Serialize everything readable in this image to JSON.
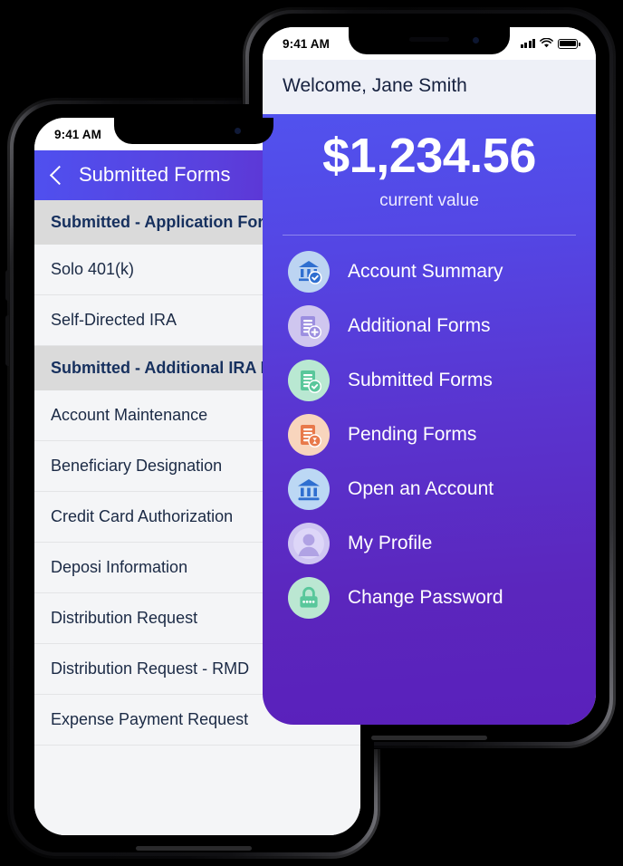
{
  "front_phone": {
    "status_bar": {
      "time": "9:41 AM",
      "signal_icon": "cellular-bars-icon",
      "wifi_icon": "wifi-icon",
      "battery_icon": "battery-full-icon"
    },
    "welcome": "Welcome, Jane Smith",
    "balance": {
      "amount": "$1,234.56",
      "caption": "current value"
    },
    "menu": [
      {
        "label": "Account Summary",
        "icon": "bank-check-icon",
        "circle_color": "#bcd4f2",
        "glyph_color": "#2f6fd0"
      },
      {
        "label": "Additional Forms",
        "icon": "document-plus-icon",
        "circle_color": "#cfc6ef",
        "glyph_color": "#7f6fcf"
      },
      {
        "label": "Submitted Forms",
        "icon": "document-check-icon",
        "circle_color": "#b9e8d2",
        "glyph_color": "#4cbf96"
      },
      {
        "label": "Pending Forms",
        "icon": "document-clock-icon",
        "circle_color": "#f8d5bd",
        "glyph_color": "#e8794a"
      },
      {
        "label": "Open an Account",
        "icon": "bank-icon",
        "circle_color": "#bcd8f4",
        "glyph_color": "#2f6fd0"
      },
      {
        "label": "My Profile",
        "icon": "user-avatar-icon",
        "circle_color": "#cfc6f2",
        "glyph_color": "#b0a2e4"
      },
      {
        "label": "Change Password",
        "icon": "lock-dots-icon",
        "circle_color": "#bbe7d2",
        "glyph_color": "#59c79b"
      }
    ]
  },
  "back_phone": {
    "status_bar": {
      "time": "9:41 AM"
    },
    "nav": {
      "back_icon": "chevron-left-icon",
      "title": "Submitted Forms"
    },
    "sections": [
      {
        "header": "Submitted - Application Forms",
        "items": [
          "Solo 401(k)",
          "Self-Directed IRA"
        ]
      },
      {
        "header": "Submitted - Additional IRA Forms",
        "items": [
          "Account Maintenance",
          "Beneficiary Designation",
          "Credit Card Authorization",
          "Deposi Information",
          "Distribution Request",
          "Distribution Request - RMD",
          "Expense Payment Request"
        ]
      }
    ]
  },
  "theme": {
    "gradient_top": "#5152ee",
    "gradient_bottom": "#5a20bb",
    "welcome_bg": "#eef0f7",
    "navy_text": "#16213f",
    "section_bg": "#dadada",
    "list_bg": "#f4f5f7"
  }
}
